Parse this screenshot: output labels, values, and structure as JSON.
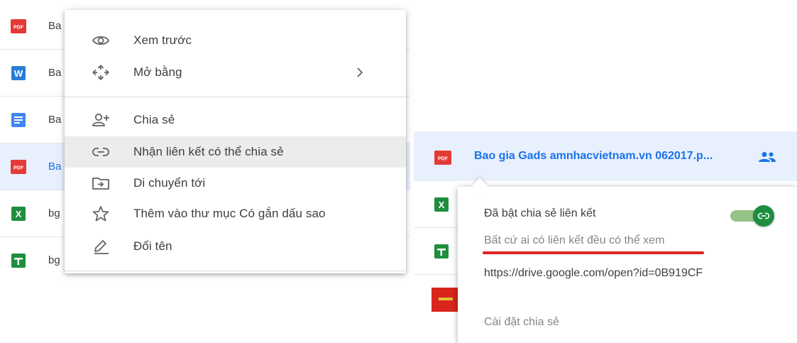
{
  "file_list": {
    "rows": [
      {
        "icon": "pdf-icon",
        "name": "Ba",
        "icon_label": "PDF"
      },
      {
        "icon": "word-doc-icon",
        "name": "Ba",
        "icon_label": "W"
      },
      {
        "icon": "google-docs-icon",
        "name": "Ba"
      },
      {
        "icon": "pdf-icon",
        "name": "Ba",
        "icon_label": "PDF"
      },
      {
        "icon": "excel-icon",
        "name": "bg",
        "icon_label": "X"
      },
      {
        "icon": "google-sheets-icon",
        "name": "bg"
      }
    ]
  },
  "context_menu": {
    "items": [
      {
        "icon": "eye-icon",
        "label": "Xem trước"
      },
      {
        "icon": "move-arrows-icon",
        "label": "Mở bằng",
        "submenu": true
      },
      {
        "icon": "add-person-icon",
        "label": "Chia sẻ"
      },
      {
        "icon": "link-icon",
        "label": "Nhận liên kết có thể chia sẻ",
        "highlighted": true
      },
      {
        "icon": "folder-move-icon",
        "label": "Di chuyển tới"
      },
      {
        "icon": "star-icon",
        "label": "Thêm vào thư mục Có gắn dấu sao"
      },
      {
        "icon": "pencil-icon",
        "label": "Đổi tên"
      }
    ]
  },
  "shared_file": {
    "name": "Bao gia Gads amnhacvietnam.vn 062017.p...",
    "icon_label": "PDF",
    "status_icon": "shared-people-icon"
  },
  "link_popup": {
    "title": "Đã bật chia sẻ liên kết",
    "access": "Bất cứ ai có liên kết đều có thể xem",
    "url": "https://drive.google.com/open?id=0B919CF",
    "settings": "Cài đặt chia sẻ",
    "toggle_on": true
  },
  "colors": {
    "pdf_red": "#e53935",
    "word_blue": "#2b7cd3",
    "docs_blue": "#4285f4",
    "sheets_green": "#1e8e3e",
    "selected_bg": "#e8f0fe",
    "link_blue": "#1a73e8",
    "annotation_red": "#e22222"
  }
}
